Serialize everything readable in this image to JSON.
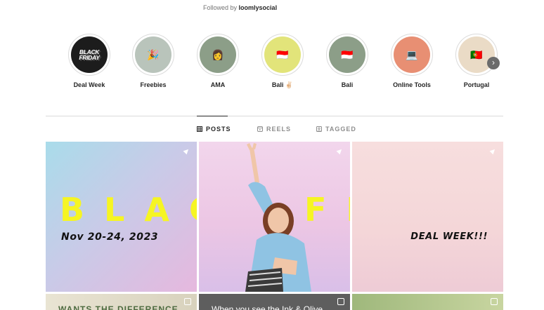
{
  "followed_by": {
    "prefix": "Followed by",
    "user": "loomlysocial"
  },
  "highlights": [
    {
      "label": "Deal Week",
      "bg": "#1c1c1c",
      "logo_line1": "BLACK",
      "logo_line2": "FRIDAY"
    },
    {
      "label": "Freebies",
      "bg": "#b9c4bb",
      "emoji": "🎉"
    },
    {
      "label": "AMA",
      "bg": "#8c9e88",
      "emoji": "👩"
    },
    {
      "label": "Bali ✌🏻",
      "bg": "#e2e47a",
      "emoji": "🇮🇩"
    },
    {
      "label": "Bali",
      "bg": "#8c9e88",
      "emoji": "🇮🇩"
    },
    {
      "label": "Online Tools",
      "bg": "#e88f73",
      "emoji": "💻"
    },
    {
      "label": "Portugal",
      "bg": "#eadbc6",
      "emoji": "🇵🇹"
    }
  ],
  "next_icon": "chevron-right-icon",
  "tabs": [
    {
      "label": "POSTS",
      "icon": "grid-icon",
      "active": true
    },
    {
      "label": "REELS",
      "icon": "reels-icon",
      "active": false
    },
    {
      "label": "TAGGED",
      "icon": "tagged-icon",
      "active": false
    }
  ],
  "posts": {
    "banner_word_left": "BLACK",
    "banner_word_right": "FRIDAY",
    "date_text": "Nov 20-24, 2023",
    "deal_text": "DEAL WEEK!!!",
    "second_row_caption_left": "WANTS THE DIFFERENCE",
    "second_row_caption_mid": "When you see the Ink & Olive"
  },
  "colors": {
    "banner_yellow": "#f6f523",
    "accent_dark": "#262626"
  }
}
